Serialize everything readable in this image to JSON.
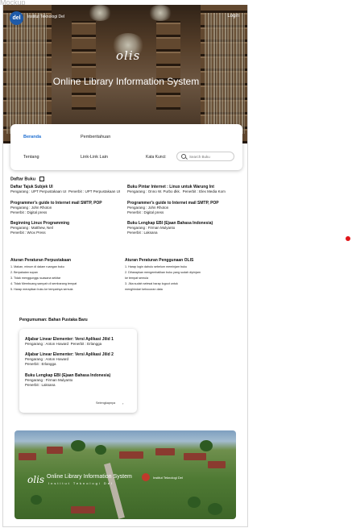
{
  "page_top_cut": "Mockup",
  "header": {
    "logo_text": "del",
    "institution": "Institut Teknologi Del",
    "login_label": "Login",
    "olis_logo": "olis",
    "title": "Online Library Information System"
  },
  "nav": {
    "beranda": "Beranda",
    "pemberitahuan": "Pemberitahuan",
    "tentang": "Tentang",
    "link_lain": "Link-Link Lain",
    "kata_kunci": "Kata Kunci:",
    "search_placeholder": "Search Buku"
  },
  "daftar_buku": {
    "title": "Daftar Buku",
    "books": [
      {
        "title": "Daftar Tajuk Subjek UI",
        "pengarang": "Pengarang : UPT Perpustakaan UI",
        "penerbit": "Penerbit     : UPT Perpustakaan UI"
      },
      {
        "title": "Buku Pintar Internet : Linux untuk Warung Int",
        "pengarang": "Pengarang : Onno W. Purbo dkk.",
        "penerbit": "Penerbit     : Elex Media Kom"
      },
      {
        "title": "Programmer's guide to Internet mail SMTP, POP",
        "pengarang": "Pengarang : John Rhoton",
        "penerbit": "Penerbit     : Digital press"
      },
      {
        "title": "Programmer's guide to Internet mail SMTP, POP",
        "pengarang": "Pengarang : John Rhoton",
        "penerbit": "Penerbit     : Digital press"
      },
      {
        "title": "Beginning Linux Programming",
        "pengarang": "Pengarang : Matthew, Neil",
        "penerbit": "Penerbit     : Wrox Press"
      },
      {
        "title": "Buku Lengkap EBI (Ejaan Bahasa Indonesia)",
        "pengarang": "Pengarang : Firman Mulyanto",
        "penerbit": "Penerbit     : Laksana"
      }
    ]
  },
  "aturan_perpustakaan": {
    "title": "Aturan Peraturan Perpustakaan",
    "items": [
      "1. Makan, minum di dalam ruangan buku",
      "2. Berpakaian sopan",
      "3. Tidak menggunggu suasana sekitar",
      "4. Tidak Membuang sampah di sembarang tempat",
      "5. Harap merapikan buku ke tempatnya semula"
    ]
  },
  "aturan_olis": {
    "title": "Aturan Peraturan Penggunaan OLIS",
    "items": [
      "1. Harap login dahulu sebelum meminjam buku",
      "2. Diharapkan mengembalikan buku yang sudah dipinjam",
      "ke tempat semula",
      "3. Jika sudah selesai harap logout untuk",
      "menghindari kebocoran data"
    ]
  },
  "pengumuman": {
    "title": "Pengumuman: Bahan Pustaka Baru",
    "items": [
      {
        "title": "Aljabar Linear Elementer: Versi Aplikasi Jilid 1",
        "pengarang": "Pengarang : Anton Howard",
        "penerbit": "Penerbit     : Erlangga"
      },
      {
        "title": "Aljabar Linear Elementer: Versi Aplikasi Jilid 2",
        "pengarang": "Pengarang : Anton Howard",
        "penerbit": "Penerbit     : Erlangga"
      },
      {
        "title": "Buku Lengkap EBI (Ejaan Bahasa Indonesia)",
        "pengarang": "Pengarang : Firman Mulyanto",
        "penerbit": "Penerbit     : Laksana"
      }
    ],
    "more_label": "Selengkapnya"
  },
  "banner": {
    "olis": "olis",
    "title": "Online Library Information System",
    "subtitle": "Institut Teknologi Del",
    "institution": "Institut Teknologi Del"
  },
  "colors": {
    "accent": "#1f6fd1",
    "marker": "#e0161a"
  }
}
